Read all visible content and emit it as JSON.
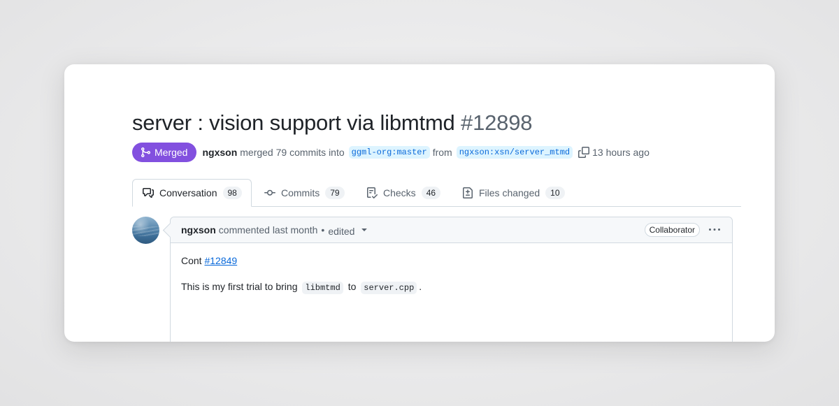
{
  "pr": {
    "title": "server : vision support via libmtmd",
    "number": "#12898",
    "status": "Merged",
    "author": "ngxson",
    "merged_text": "merged 79 commits into",
    "base_branch": "ggml-org:master",
    "from_text": "from",
    "head_branch": "ngxson:xsn/server_mtmd",
    "time": "13 hours ago"
  },
  "tabs": [
    {
      "label": "Conversation",
      "count": "98",
      "icon": "comment-discussion-icon"
    },
    {
      "label": "Commits",
      "count": "79",
      "icon": "git-commit-icon"
    },
    {
      "label": "Checks",
      "count": "46",
      "icon": "checklist-icon"
    },
    {
      "label": "Files changed",
      "count": "10",
      "icon": "file-diff-icon"
    }
  ],
  "comment": {
    "author": "ngxson",
    "meta": "commented last month",
    "separator": "•",
    "edited": "edited",
    "role": "Collaborator",
    "line1_prefix": "Cont",
    "line1_link": "#12849",
    "line2_before": "This is my first trial to bring",
    "code1": "libmtmd",
    "line2_mid": "to",
    "code2": "server.cpp",
    "line2_after": "."
  },
  "colors": {
    "merged_badge": "#8250df",
    "link": "#0969da",
    "branch_bg": "#ddf4ff"
  }
}
